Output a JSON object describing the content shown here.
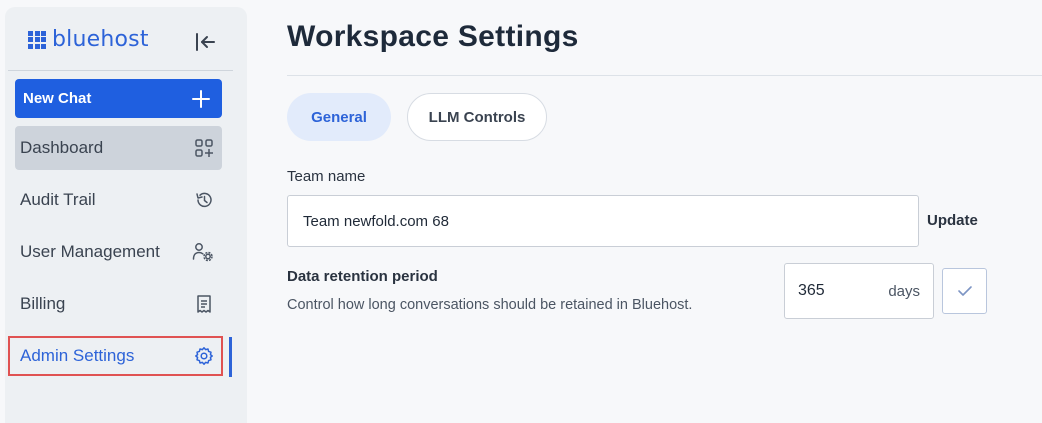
{
  "brand": {
    "name": "bluehost"
  },
  "sidebar": {
    "new_chat": "New Chat",
    "items": [
      {
        "label": "Dashboard",
        "icon": "dashboard-grid-icon"
      },
      {
        "label": "Audit Trail",
        "icon": "history-icon"
      },
      {
        "label": "User Management",
        "icon": "user-settings-icon"
      },
      {
        "label": "Billing",
        "icon": "receipt-icon"
      },
      {
        "label": "Admin Settings",
        "icon": "gear-icon"
      }
    ]
  },
  "page": {
    "title": "Workspace Settings",
    "tabs": [
      {
        "label": "General",
        "active": true
      },
      {
        "label": "LLM Controls",
        "active": false
      }
    ],
    "team_name": {
      "label": "Team name",
      "value": "Team newfold.com 68",
      "action": "Update"
    },
    "retention": {
      "label": "Data retention period",
      "description": "Control how long conversations should be retained in Bluehost.",
      "value": "365",
      "unit": "days"
    }
  },
  "colors": {
    "accent": "#2d63d8",
    "primary_button": "#1f5fe0",
    "highlight": "#e05252",
    "sidebar_bg": "#edf0f3"
  }
}
